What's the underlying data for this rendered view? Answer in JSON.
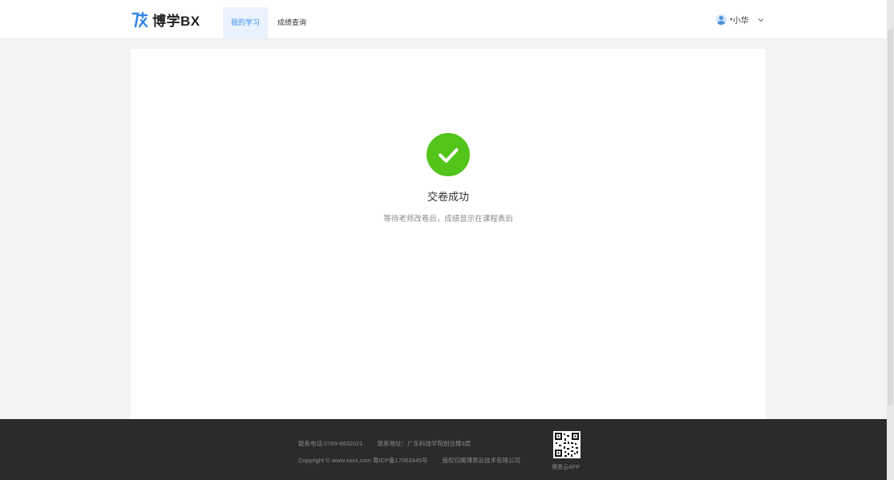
{
  "header": {
    "logo_text": "博学BX",
    "nav": [
      {
        "label": "我的学习",
        "active": true
      },
      {
        "label": "成绩查询",
        "active": false
      }
    ],
    "user_name": "*小华"
  },
  "result": {
    "title": "交卷成功",
    "subtitle": "等待老师改卷后，成绩显示在课程表后"
  },
  "footer": {
    "phone": "联系电话:0769-6832021",
    "address": "联系地址：广东科技学院创业楼9层",
    "copyright": "Copyright © www.xxxx.com 粤ICP备17063345号",
    "owner": "版权归属博思云技术有限公司",
    "app_label": "博思云APP"
  },
  "colors": {
    "accent": "#3b8ee6",
    "success": "#52c41a",
    "footer_bg": "#2b2b2b"
  }
}
